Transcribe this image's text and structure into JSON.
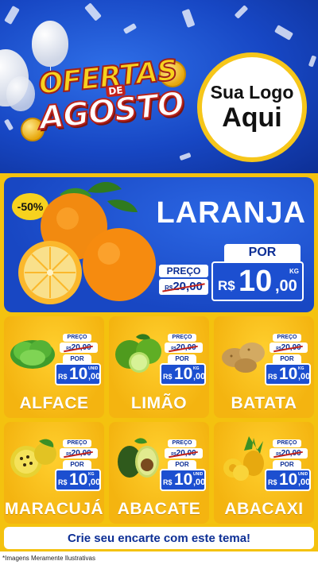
{
  "header": {
    "promo_line1": "OFERTAS",
    "promo_de": "DE",
    "promo_line2": "AGOSTO",
    "logo_line1": "Sua Logo",
    "logo_line2": "Aqui"
  },
  "featured": {
    "discount": "-50%",
    "name": "LARANJA",
    "preco_label": "PREÇO",
    "old_prefix": "R$",
    "old_value": "20,00",
    "por_label": "POR",
    "currency": "R$",
    "price_int": "10",
    "price_cents": ",00",
    "unit": "KG",
    "image_icon": "orange-icon"
  },
  "products": [
    {
      "name": "ALFACE",
      "preco_label": "PREÇO",
      "old_prefix": "R$",
      "old_value": "20,00",
      "por_label": "POR",
      "currency": "R$",
      "price_int": "10",
      "price_cents": ",00",
      "unit": "UNID",
      "icon": "lettuce-icon"
    },
    {
      "name": "LIMÃO",
      "preco_label": "PREÇO",
      "old_prefix": "R$",
      "old_value": "20,00",
      "por_label": "POR",
      "currency": "R$",
      "price_int": "10",
      "price_cents": ",00",
      "unit": "KG",
      "icon": "lime-icon"
    },
    {
      "name": "BATATA",
      "preco_label": "PREÇO",
      "old_prefix": "R$",
      "old_value": "20,00",
      "por_label": "POR",
      "currency": "R$",
      "price_int": "10",
      "price_cents": ",00",
      "unit": "KG",
      "icon": "potato-icon"
    },
    {
      "name": "MARACUJÁ",
      "preco_label": "PREÇO",
      "old_prefix": "R$",
      "old_value": "20,00",
      "por_label": "POR",
      "currency": "R$",
      "price_int": "10",
      "price_cents": ",00",
      "unit": "KG",
      "icon": "passion-fruit-icon"
    },
    {
      "name": "ABACATE",
      "preco_label": "PREÇO",
      "old_prefix": "R$",
      "old_value": "20,00",
      "por_label": "POR",
      "currency": "R$",
      "price_int": "10",
      "price_cents": ",00",
      "unit": "UNID",
      "icon": "avocado-icon"
    },
    {
      "name": "ABACAXI",
      "preco_label": "PREÇO",
      "old_prefix": "R$",
      "old_value": "20,00",
      "por_label": "POR",
      "currency": "R$",
      "price_int": "10",
      "price_cents": ",00",
      "unit": "UNID",
      "icon": "pineapple-icon"
    }
  ],
  "footer": {
    "cta": "Crie seu encarte com este tema!",
    "disclaimer": "*Imagens Meramente Ilustrativas"
  },
  "colors": {
    "blue": "#1847c3",
    "navy": "#0d2f95",
    "yellow": "#f4c20f",
    "card_yellow": "#ffcf2e",
    "red": "#c2221b"
  }
}
